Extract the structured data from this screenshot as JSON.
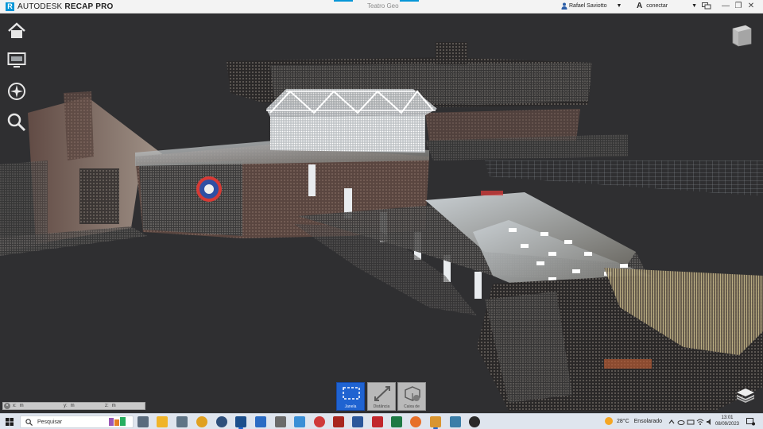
{
  "app": {
    "brand_prefix": "AUTODESK",
    "brand_product": "RECAP PRO",
    "document_title": "Teatro Geo",
    "user_name": "Rafael Saviotto",
    "connect_label": "conectar",
    "accent_color": "#0696d7"
  },
  "window_controls": {
    "minimize": "—",
    "restore": "❐",
    "close": "✕"
  },
  "nav_tools": [
    {
      "name": "home-icon"
    },
    {
      "name": "presentation-icon"
    },
    {
      "name": "navigate-wheel-icon"
    },
    {
      "name": "zoom-search-icon"
    }
  ],
  "coordinates": {
    "x_label": "x:",
    "x_unit": "m",
    "y_label": "y:",
    "y_unit": "m",
    "z_label": "z:",
    "z_unit": "m"
  },
  "palette": [
    {
      "label": "Janela",
      "icon": "window-select-icon",
      "active": true
    },
    {
      "label": "Distância",
      "icon": "measure-distance-icon",
      "active": false
    },
    {
      "label": "Caixa de",
      "icon": "limit-box-icon",
      "active": false
    }
  ],
  "taskbar": {
    "search_placeholder": "Pesquisar",
    "weather_temp": "28°C",
    "weather_text": "Ensolarado",
    "time": "13:01",
    "date": "08/09/2023"
  }
}
